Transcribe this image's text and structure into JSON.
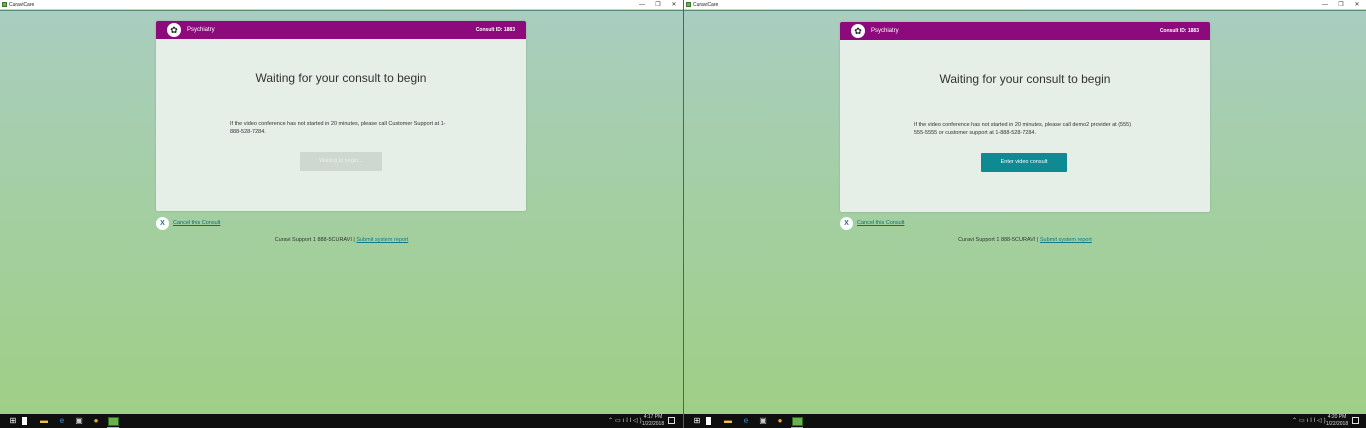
{
  "screens": [
    {
      "app_title": "CuraviCare",
      "window_controls": {
        "minimize": "—",
        "maximize": "❐",
        "close": "✕"
      },
      "card": {
        "specialty": "Psychiatry",
        "consult_id": "Consult ID: 1883",
        "title": "Waiting for your consult to begin",
        "message": "If the video conference has not started in 20 minutes, please call Customer Support at 1-888-528-7284.",
        "button_label": "Waiting to begin...",
        "button_state": "disabled"
      },
      "cancel_label": "Cancel this Consult",
      "footer": {
        "support_text": "Curavi Support 1 888-5CURAVI | ",
        "report_link": "Submit system report"
      },
      "taskbar": {
        "time": "4:17 PM",
        "date": "1/22/2018"
      }
    },
    {
      "app_title": "CuraviCare",
      "window_controls": {
        "minimize": "—",
        "maximize": "❐",
        "close": "✕"
      },
      "card": {
        "specialty": "Psychiatry",
        "consult_id": "Consult ID: 1883",
        "title": "Waiting for your consult to begin",
        "message": "If the video conference has not started in 20 minutes, please call demo2 provider at (555) 555-5555 or customer support at 1-888-528-7284.",
        "button_label": "Enter video consult",
        "button_state": "active"
      },
      "cancel_label": "Cancel this Consult",
      "footer": {
        "support_text": "Curavi Support 1 888-5CURAVI | ",
        "report_link": "Submit system report"
      },
      "taskbar": {
        "time": "4:20 PM",
        "date": "1/22/2018"
      }
    }
  ],
  "icons": {
    "specialty": "brain-icon",
    "cancel": "x-icon",
    "taskbar": [
      "windows-start-icon",
      "task-view-icon",
      "file-explorer-icon",
      "edge-icon",
      "store-icon",
      "chrome-icon",
      "curavicare-app-icon"
    ],
    "tray": [
      "chevron-up-icon",
      "battery-icon",
      "network-icon",
      "volume-icon",
      "notification-icon"
    ]
  },
  "colors": {
    "header": "#8c0a7c",
    "primary_button": "#0e8a93",
    "link": "#0e7a86",
    "gradient_top": "#a9cdc0",
    "gradient_bottom": "#9fcf86"
  }
}
